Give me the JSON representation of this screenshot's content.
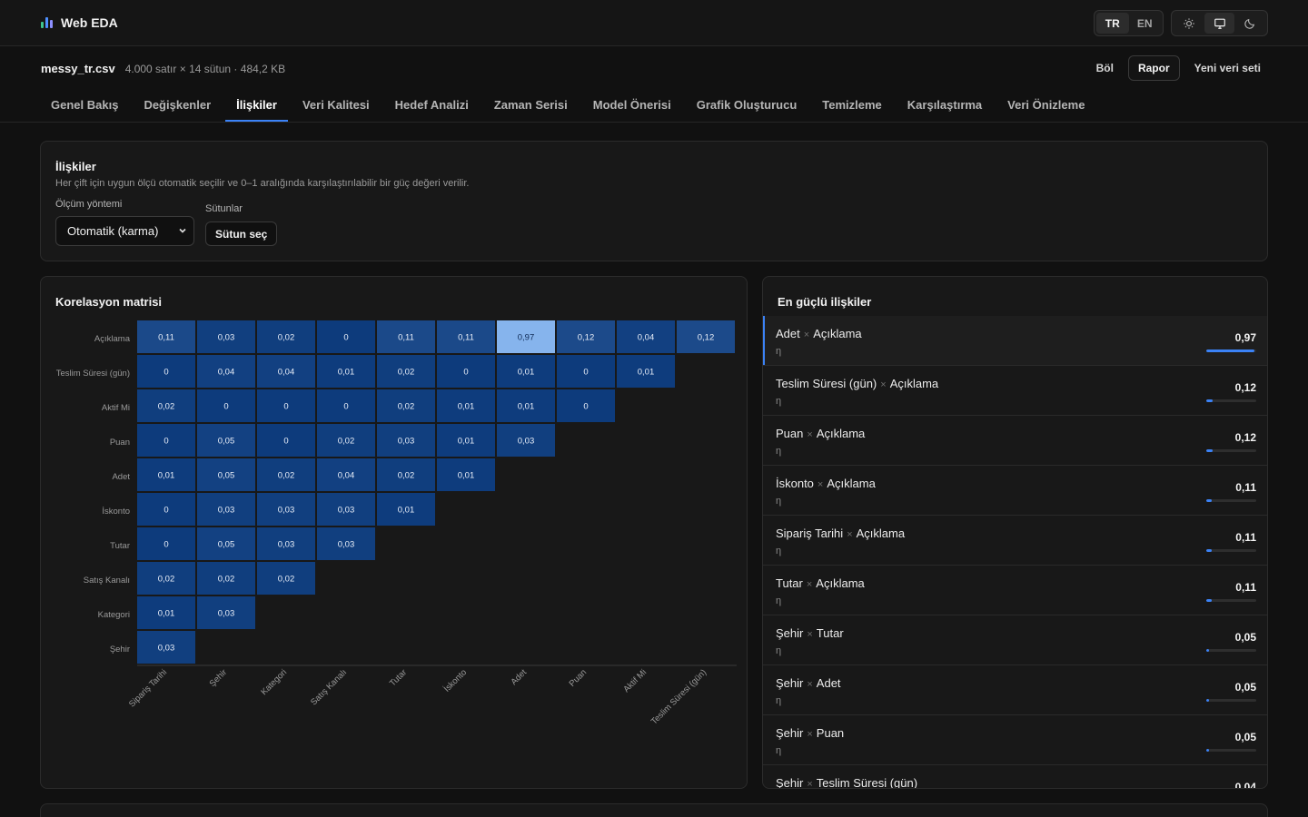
{
  "app": {
    "name": "Web EDA"
  },
  "lang": {
    "options": [
      "TR",
      "EN"
    ],
    "active": "TR"
  },
  "theme": {
    "options": [
      "sun-icon",
      "monitor-icon",
      "moon-icon"
    ],
    "active": "monitor-icon"
  },
  "dataset": {
    "file": "messy_tr.csv",
    "meta": "4.000 satır × 14 sütun · 484,2 KB"
  },
  "actions": {
    "split": "Böl",
    "report": "Rapor",
    "new_dataset": "Yeni veri seti"
  },
  "tabs": [
    {
      "label": "Genel Bakış"
    },
    {
      "label": "Değişkenler"
    },
    {
      "label": "İlişkiler",
      "active": true
    },
    {
      "label": "Veri Kalitesi"
    },
    {
      "label": "Hedef Analizi"
    },
    {
      "label": "Zaman Serisi"
    },
    {
      "label": "Model Önerisi"
    },
    {
      "label": "Grafik Oluşturucu"
    },
    {
      "label": "Temizleme"
    },
    {
      "label": "Karşılaştırma"
    },
    {
      "label": "Veri Önizleme"
    }
  ],
  "relations": {
    "title": "İlişkiler",
    "description": "Her çift için uygun ölçü otomatik seçilir ve 0–1 aralığında karşılaştırılabilir bir güç değeri verilir.",
    "method_label": "Ölçüm yöntemi",
    "method_value": "Otomatik (karma)",
    "columns_label": "Sütunlar",
    "columns_button": "Sütun seç"
  },
  "matrix": {
    "title": "Korelasyon matrisi",
    "colors": {
      "low": "#0d3b7c",
      "high": "#8ab8f0"
    }
  },
  "chart_data": {
    "type": "heatmap",
    "title": "Korelasyon matrisi",
    "y_labels": [
      "Açıklama",
      "Teslim Süresi (gün)",
      "Aktif Mi",
      "Puan",
      "Adet",
      "İskonto",
      "Tutar",
      "Satış Kanalı",
      "Kategori",
      "Şehir"
    ],
    "x_labels": [
      "Sipariş Tarihi",
      "Şehir",
      "Kategori",
      "Satış Kanalı",
      "Tutar",
      "İskonto",
      "Adet",
      "Puan",
      "Aktif Mi",
      "Teslim Süresi (gün)"
    ],
    "values": [
      [
        "0,11",
        "0,03",
        "0,02",
        "0",
        "0,11",
        "0,11",
        "0,97",
        "0,12",
        "0,04",
        "0,12"
      ],
      [
        "0",
        "0,04",
        "0,04",
        "0,01",
        "0,02",
        "0",
        "0,01",
        "0",
        "0,01"
      ],
      [
        "0,02",
        "0",
        "0",
        "0",
        "0,02",
        "0,01",
        "0,01",
        "0"
      ],
      [
        "0",
        "0,05",
        "0",
        "0,02",
        "0,03",
        "0,01",
        "0,03"
      ],
      [
        "0,01",
        "0,05",
        "0,02",
        "0,04",
        "0,02",
        "0,01"
      ],
      [
        "0",
        "0,03",
        "0,03",
        "0,03",
        "0,01"
      ],
      [
        "0",
        "0,05",
        "0,03",
        "0,03"
      ],
      [
        "0,02",
        "0,02",
        "0,02"
      ],
      [
        "0,01",
        "0,03"
      ],
      [
        "0,03"
      ]
    ],
    "range": [
      0,
      1
    ]
  },
  "strongest": {
    "title": "En güçlü ilişkiler",
    "measure": "η",
    "items": [
      {
        "a": "Adet",
        "b": "Açıklama",
        "value": "0,97",
        "level": 0.97
      },
      {
        "a": "Teslim Süresi (gün)",
        "b": "Açıklama",
        "value": "0,12",
        "level": 0.12
      },
      {
        "a": "Puan",
        "b": "Açıklama",
        "value": "0,12",
        "level": 0.12
      },
      {
        "a": "İskonto",
        "b": "Açıklama",
        "value": "0,11",
        "level": 0.11
      },
      {
        "a": "Sipariş Tarihi",
        "b": "Açıklama",
        "value": "0,11",
        "level": 0.11
      },
      {
        "a": "Tutar",
        "b": "Açıklama",
        "value": "0,11",
        "level": 0.11
      },
      {
        "a": "Şehir",
        "b": "Tutar",
        "value": "0,05",
        "level": 0.05
      },
      {
        "a": "Şehir",
        "b": "Adet",
        "value": "0,05",
        "level": 0.05
      },
      {
        "a": "Şehir",
        "b": "Puan",
        "value": "0,05",
        "level": 0.05
      },
      {
        "a": "Şehir",
        "b": "Teslim Süresi (gün)",
        "value": "0,04",
        "level": 0.04
      }
    ]
  }
}
